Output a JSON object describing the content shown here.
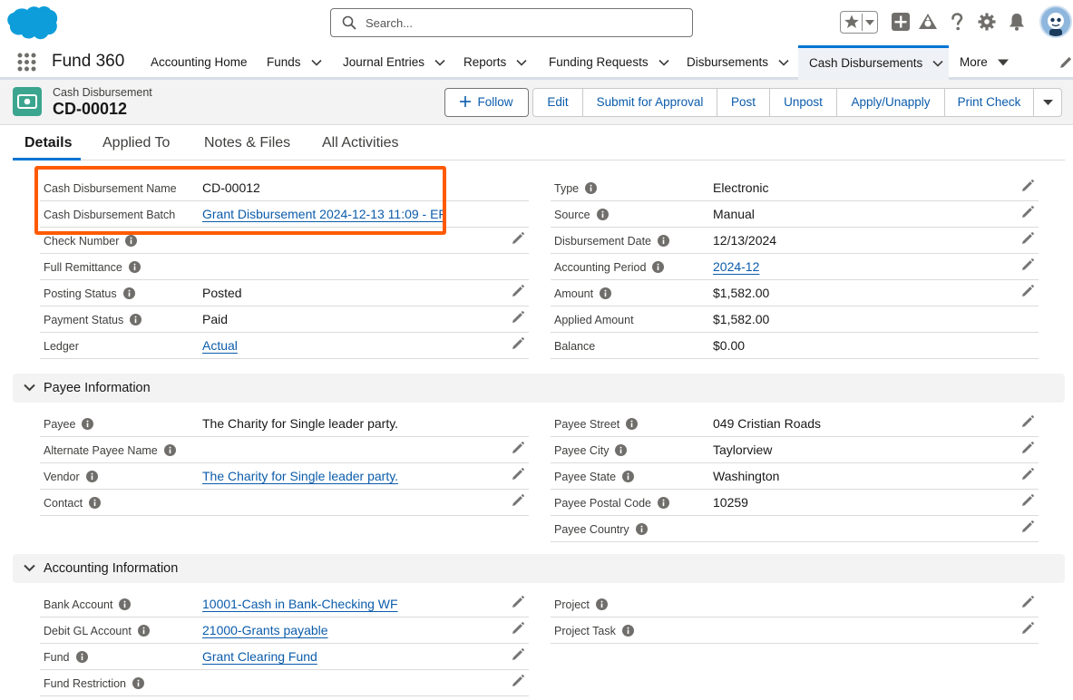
{
  "header": {
    "search_placeholder": "Search...",
    "icons": [
      "salesforce-logo",
      "favorites-star-icon",
      "global-actions-plus-icon",
      "trailhead-icon",
      "help-icon",
      "setup-gear-icon",
      "notifications-bell-icon",
      "user-avatar"
    ]
  },
  "nav": {
    "app_name": "Fund 360",
    "items": [
      {
        "label": "Accounting Home",
        "chevron": false
      },
      {
        "label": "Funds",
        "chevron": true
      },
      {
        "label": "Journal Entries",
        "chevron": true
      },
      {
        "label": "Reports",
        "chevron": true
      },
      {
        "label": "Funding Requests",
        "chevron": true
      },
      {
        "label": "Disbursements",
        "chevron": true
      },
      {
        "label": "Cash Disbursements",
        "chevron": true,
        "active": true
      },
      {
        "label": "More",
        "chevron": true
      }
    ]
  },
  "record": {
    "object_type": "Cash Disbursement",
    "name": "CD-00012",
    "buttons": {
      "follow": "Follow",
      "edit": "Edit",
      "submit": "Submit for Approval",
      "post": "Post",
      "unpost": "Unpost",
      "apply": "Apply/Unapply",
      "print": "Print Check"
    }
  },
  "tabs": [
    "Details",
    "Applied To",
    "Notes & Files",
    "All Activities"
  ],
  "details": {
    "left": [
      {
        "label": "Cash Disbursement Name",
        "value": "CD-00012",
        "info": false,
        "link": false,
        "edit": false
      },
      {
        "label": "Cash Disbursement Batch",
        "value": "Grant Disbursement 2024-12-13 11:09 - EF",
        "info": false,
        "link": true,
        "edit": false
      },
      {
        "label": "Check Number",
        "value": "",
        "info": true,
        "link": false,
        "edit": true
      },
      {
        "label": "Full Remittance",
        "value": "",
        "info": true,
        "link": false,
        "edit": false
      },
      {
        "label": "Posting Status",
        "value": "Posted",
        "info": true,
        "link": false,
        "edit": true
      },
      {
        "label": "Payment Status",
        "value": "Paid",
        "info": true,
        "link": false,
        "edit": true
      },
      {
        "label": "Ledger",
        "value": "Actual",
        "info": false,
        "link": true,
        "edit": true
      }
    ],
    "right": [
      {
        "label": "Type",
        "value": "Electronic",
        "info": true,
        "link": false,
        "edit": true
      },
      {
        "label": "Source",
        "value": "Manual",
        "info": true,
        "link": false,
        "edit": true
      },
      {
        "label": "Disbursement Date",
        "value": "12/13/2024",
        "info": true,
        "link": false,
        "edit": true
      },
      {
        "label": "Accounting Period",
        "value": "2024-12",
        "info": true,
        "link": true,
        "edit": true
      },
      {
        "label": "Amount",
        "value": "$1,582.00",
        "info": true,
        "link": false,
        "edit": true
      },
      {
        "label": "Applied Amount",
        "value": "$1,582.00",
        "info": false,
        "link": false,
        "edit": false
      },
      {
        "label": "Balance",
        "value": "$0.00",
        "info": false,
        "link": false,
        "edit": false
      }
    ]
  },
  "payee_section": {
    "title": "Payee Information",
    "left": [
      {
        "label": "Payee",
        "value": "The Charity for Single leader party.",
        "info": true,
        "link": false,
        "edit": false
      },
      {
        "label": "Alternate Payee Name",
        "value": "",
        "info": true,
        "link": false,
        "edit": true
      },
      {
        "label": "Vendor",
        "value": "The Charity for Single leader party.",
        "info": true,
        "link": true,
        "edit": true
      },
      {
        "label": "Contact",
        "value": "",
        "info": true,
        "link": false,
        "edit": true
      }
    ],
    "right": [
      {
        "label": "Payee Street",
        "value": "049 Cristian Roads",
        "info": true,
        "link": false,
        "edit": true
      },
      {
        "label": "Payee City",
        "value": "Taylorview",
        "info": true,
        "link": false,
        "edit": true
      },
      {
        "label": "Payee State",
        "value": "Washington",
        "info": true,
        "link": false,
        "edit": true
      },
      {
        "label": "Payee Postal Code",
        "value": "10259",
        "info": true,
        "link": false,
        "edit": true
      },
      {
        "label": "Payee Country",
        "value": "",
        "info": true,
        "link": false,
        "edit": true
      }
    ]
  },
  "accounting_section": {
    "title": "Accounting Information",
    "left": [
      {
        "label": "Bank Account",
        "value": "10001-Cash in Bank-Checking WF",
        "info": true,
        "link": true,
        "edit": true
      },
      {
        "label": "Debit GL Account",
        "value": "21000-Grants payable",
        "info": true,
        "link": true,
        "edit": true
      },
      {
        "label": "Fund",
        "value": "Grant Clearing Fund",
        "info": true,
        "link": true,
        "edit": true
      },
      {
        "label": "Fund Restriction",
        "value": "",
        "info": true,
        "link": false,
        "edit": true
      }
    ],
    "right": [
      {
        "label": "Project",
        "value": "",
        "info": true,
        "link": false,
        "edit": true
      },
      {
        "label": "Project Task",
        "value": "",
        "info": true,
        "link": false,
        "edit": true
      }
    ]
  },
  "colors": {
    "brand_blue": "#0176d3",
    "link_blue": "#0b5cab",
    "highlight_orange": "#ff5a00",
    "record_icon_green": "#3ba58f"
  }
}
